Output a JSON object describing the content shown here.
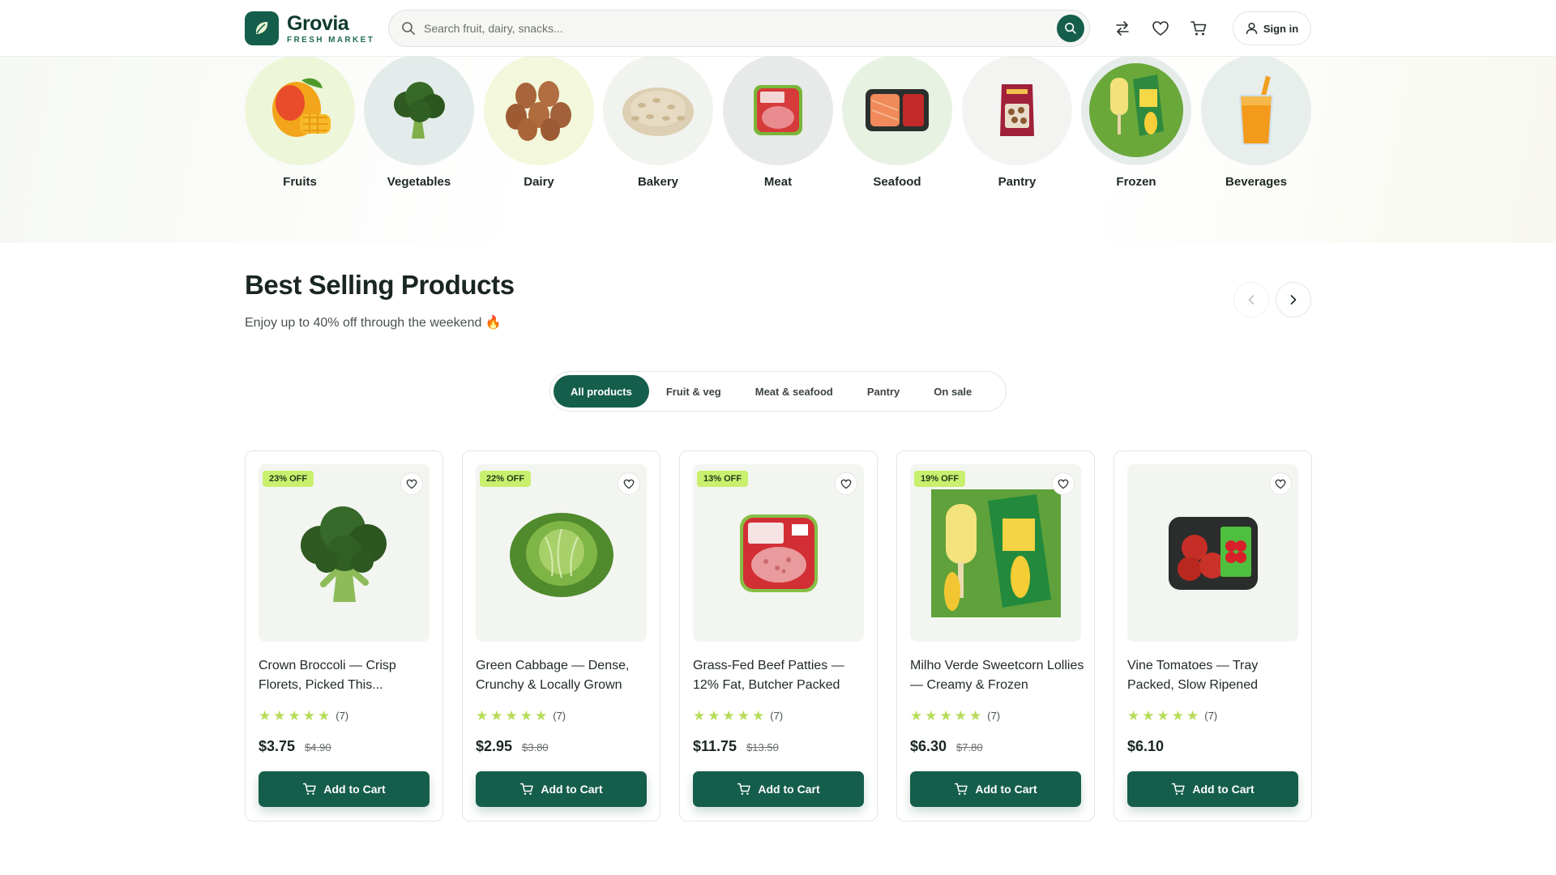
{
  "brand": {
    "name": "Grovia",
    "tagline": "FRESH MARKET"
  },
  "search": {
    "placeholder": "Search fruit, dairy, snacks..."
  },
  "header": {
    "signin_label": "Sign in"
  },
  "categories": [
    {
      "label": "Fruits",
      "bg": "#eef6da"
    },
    {
      "label": "Vegetables",
      "bg": "#e4eceb"
    },
    {
      "label": "Dairy",
      "bg": "#f3f8dc"
    },
    {
      "label": "Bakery",
      "bg": "#f1f3ef"
    },
    {
      "label": "Meat",
      "bg": "#e7eae8"
    },
    {
      "label": "Seafood",
      "bg": "#e7f2e3"
    },
    {
      "label": "Pantry",
      "bg": "#f3f4f2"
    },
    {
      "label": "Frozen",
      "bg": "#e6ecea"
    },
    {
      "label": "Beverages",
      "bg": "#e7eeec"
    }
  ],
  "section": {
    "title": "Best Selling Products",
    "subtitle": "Enjoy up to 40% off through the weekend 🔥"
  },
  "tabs": [
    {
      "label": "All products",
      "active": true
    },
    {
      "label": "Fruit & veg",
      "active": false
    },
    {
      "label": "Meat & seafood",
      "active": false
    },
    {
      "label": "Pantry",
      "active": false
    },
    {
      "label": "On sale",
      "active": false
    }
  ],
  "products": [
    {
      "badge": "23% OFF",
      "name": "Crown Broccoli — Crisp Florets, Picked This...",
      "rating_count": "(7)",
      "price": "$3.75",
      "old_price": "$4.90",
      "cart_label": "Add to Cart",
      "image": "broccoli"
    },
    {
      "badge": "22% OFF",
      "name": "Green Cabbage — Dense, Crunchy & Locally Grown",
      "rating_count": "(7)",
      "price": "$2.95",
      "old_price": "$3.80",
      "cart_label": "Add to Cart",
      "image": "cabbage"
    },
    {
      "badge": "13% OFF",
      "name": "Grass-Fed Beef Patties — 12% Fat, Butcher Packed",
      "rating_count": "(7)",
      "price": "$11.75",
      "old_price": "$13.50",
      "cart_label": "Add to Cart",
      "image": "beef-patties"
    },
    {
      "badge": "19% OFF",
      "name": "Milho Verde Sweetcorn Lollies — Creamy & Frozen",
      "rating_count": "(7)",
      "price": "$6.30",
      "old_price": "$7.80",
      "cart_label": "Add to Cart",
      "image": "corn-lollies"
    },
    {
      "badge": "",
      "name": "Vine Tomatoes — Tray Packed, Slow Ripened",
      "rating_count": "(7)",
      "price": "$6.10",
      "old_price": "",
      "cart_label": "Add to Cart",
      "image": "tomato-tray"
    }
  ],
  "colors": {
    "primary": "#155e4b",
    "badge": "#c9ef6e",
    "star": "#b6dc5a"
  }
}
